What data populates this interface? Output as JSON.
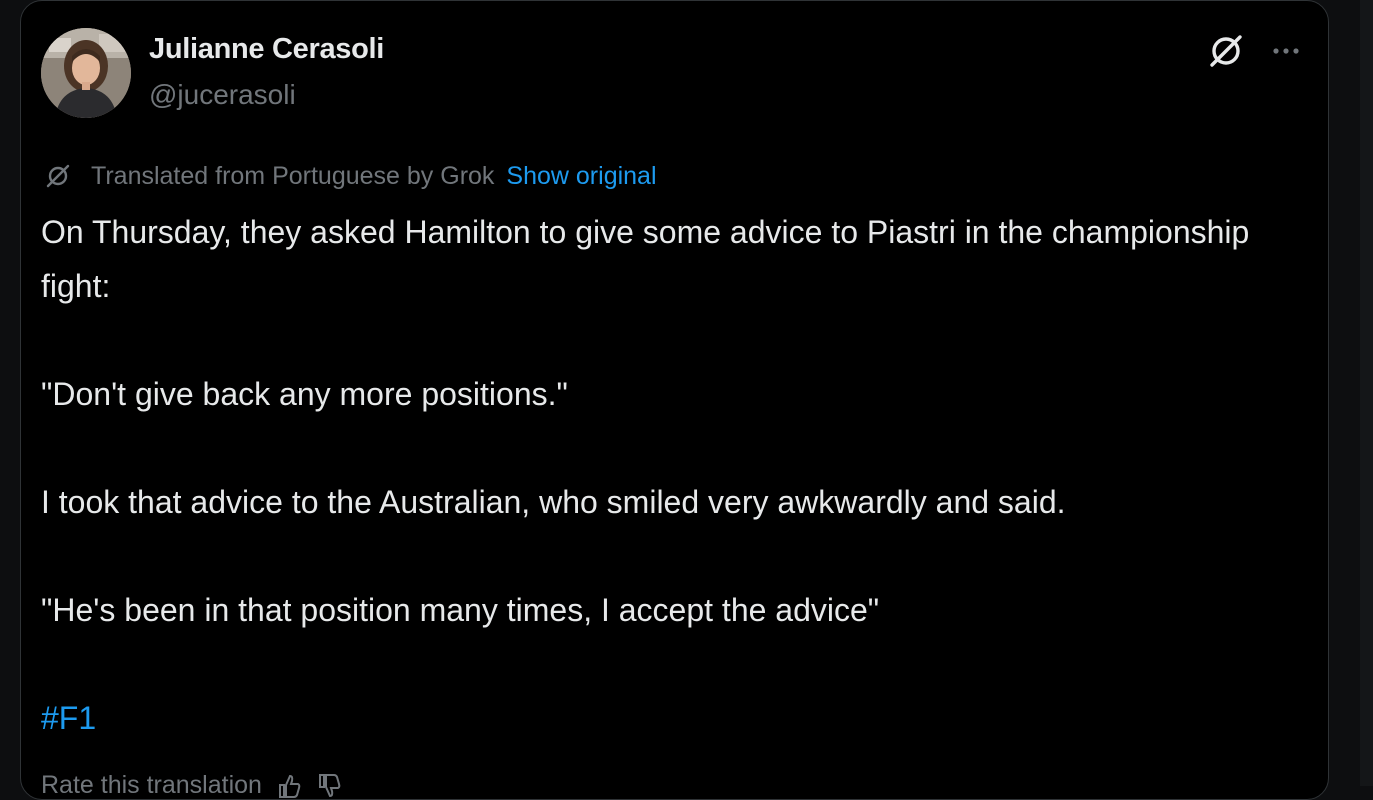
{
  "author": {
    "display_name": "Julianne Cerasoli",
    "handle": "@jucerasoli",
    "avatar_icon": "profile-photo"
  },
  "header_actions": {
    "grok_icon": "grok-icon",
    "more_icon": "more-horizontal-icon"
  },
  "translation": {
    "notice": "Translated from Portuguese by Grok",
    "show_original_label": "Show original"
  },
  "tweet": {
    "paragraph_1": "On Thursday, they asked Hamilton to give some advice to Piastri in the championship fight:",
    "paragraph_2": "\"Don't give back any more positions.\"",
    "paragraph_3": "I took that advice to the Australian, who smiled very awkwardly and said.",
    "paragraph_4": "\"He's been in that position many times, I accept the advice\"",
    "hashtag": "#F1"
  },
  "footer": {
    "rate_translation_label": "Rate this translation"
  },
  "colors": {
    "background": "#000000",
    "primary_text": "#e7e9ea",
    "secondary_text": "#71767b",
    "accent": "#1d9bf0",
    "border": "#2f3336"
  }
}
